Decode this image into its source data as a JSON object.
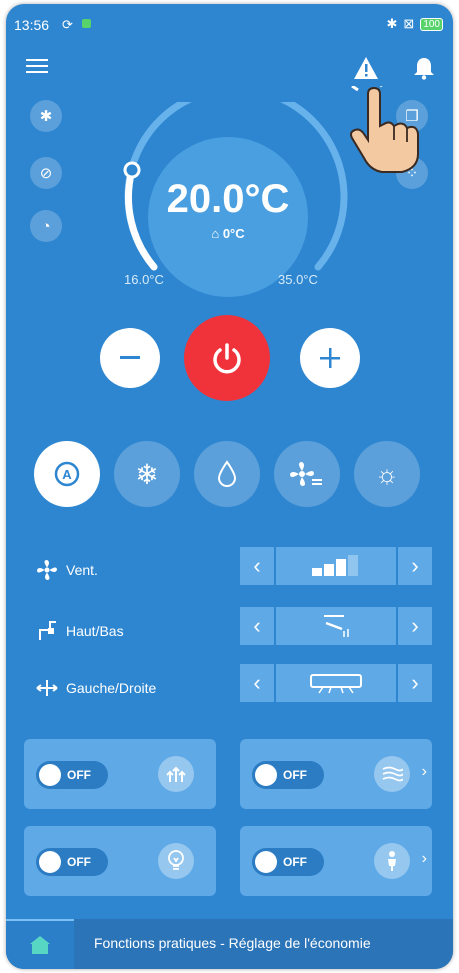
{
  "status": {
    "time": "13:56",
    "battery": "100"
  },
  "temperature": {
    "setpoint": "20.0°C",
    "room": "0°C",
    "min": "16.0°C",
    "max": "35.0°C"
  },
  "rows": [
    {
      "label": "Vent."
    },
    {
      "label": "Haut/Bas"
    },
    {
      "label": "Gauche/Droite"
    }
  ],
  "cards": [
    {
      "toggle": "OFF",
      "icon": "updraft-icon",
      "has_chevron": false
    },
    {
      "toggle": "OFF",
      "icon": "airflow-icon",
      "has_chevron": true
    },
    {
      "toggle": "OFF",
      "icon": "light-bulb-icon",
      "has_chevron": false
    },
    {
      "toggle": "OFF",
      "icon": "person-sensor-icon",
      "has_chevron": true
    }
  ],
  "modes": [
    "auto-mode",
    "cool-mode",
    "dry-mode",
    "fan-mode",
    "heat-mode"
  ],
  "bottom_bar": {
    "text": "Fonctions pratiques - Réglage de l'économie"
  },
  "colors": {
    "background": "#2e86d0",
    "power": "#f0333b",
    "panel": "#5fa9e6"
  },
  "fan_level": {
    "filled": 3,
    "total": 4
  }
}
